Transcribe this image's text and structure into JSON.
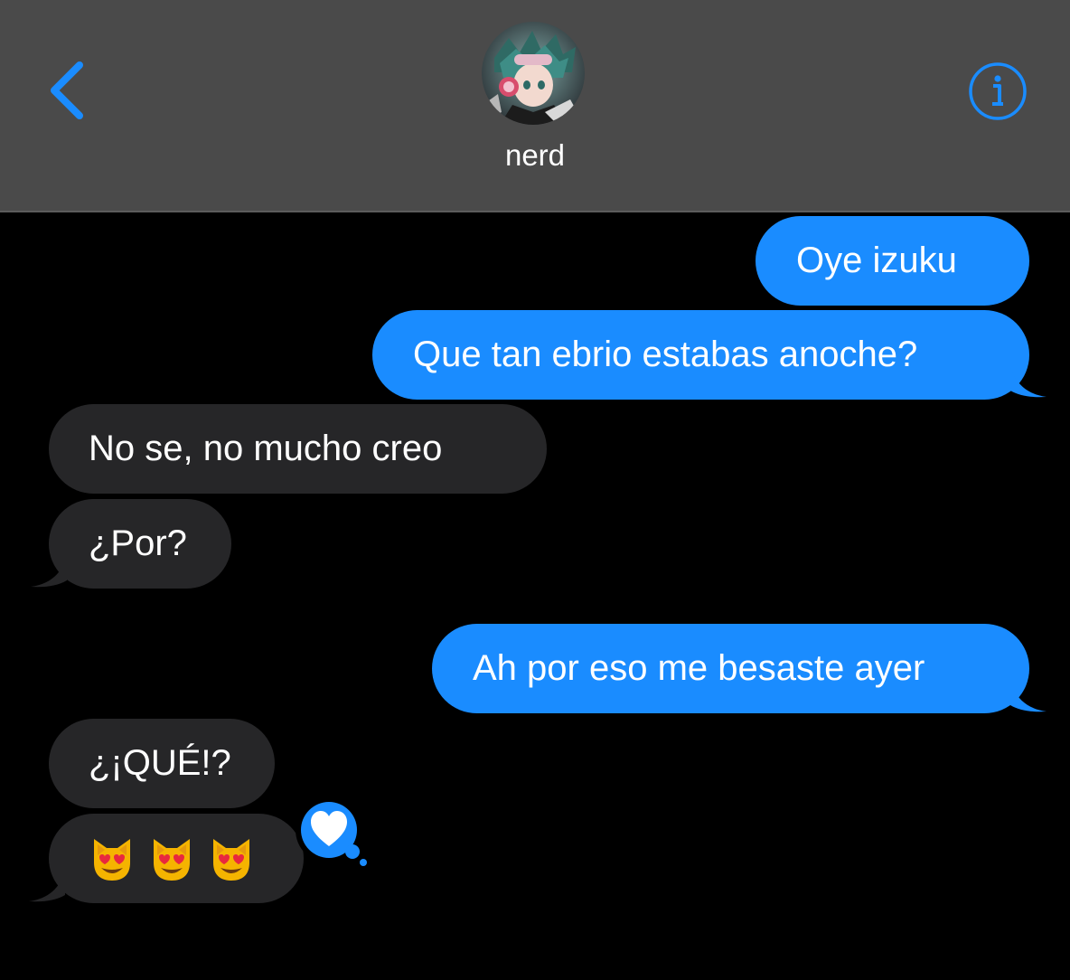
{
  "header": {
    "back_icon": "chevron-left-icon",
    "contact_name": "nerd",
    "avatar_icon": "contact-avatar",
    "info_icon": "info-icon",
    "accent_color": "#1a8cff"
  },
  "messages": [
    {
      "from": "me",
      "text": "Oye izuku"
    },
    {
      "from": "me",
      "text": "Que tan ebrio estabas anoche?"
    },
    {
      "from": "contact",
      "text": "No se, no mucho creo"
    },
    {
      "from": "contact",
      "text": "¿Por?"
    },
    {
      "from": "me",
      "text": "Ah por eso me besaste ayer"
    },
    {
      "from": "contact",
      "text": "¿¡QUÉ!?"
    },
    {
      "from": "contact",
      "emoji": [
        "heart-eyes-cat",
        "heart-eyes-cat",
        "heart-eyes-cat"
      ]
    }
  ],
  "reaction": {
    "icon": "heart-icon",
    "target": "emoji-message"
  },
  "colors": {
    "sent_bubble": "#1a8cff",
    "received_bubble": "#262628",
    "header_bg": "#4a4a4a",
    "background": "#000000"
  }
}
